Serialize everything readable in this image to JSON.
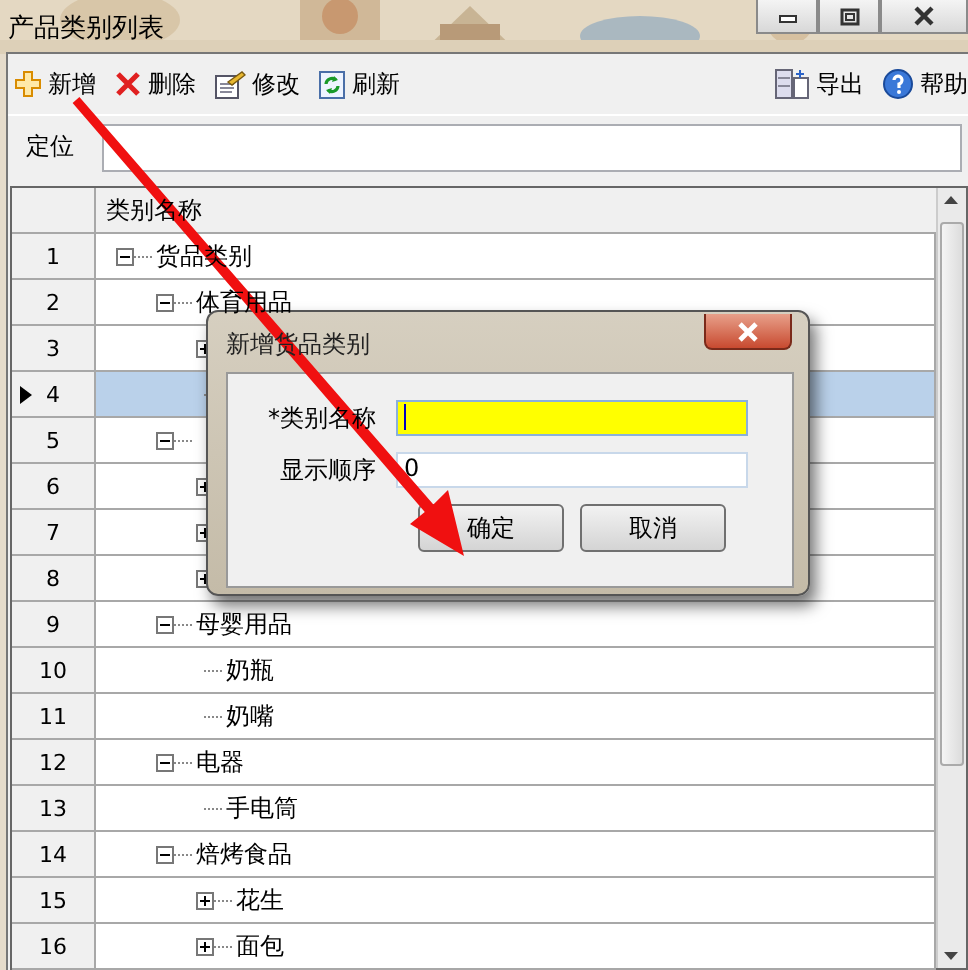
{
  "window": {
    "title": "产品类别列表"
  },
  "toolbar": {
    "left": [
      {
        "kind": "add",
        "label": "新增"
      },
      {
        "kind": "delete",
        "label": "删除"
      },
      {
        "kind": "edit",
        "label": "修改"
      },
      {
        "kind": "refresh",
        "label": "刷新"
      }
    ],
    "right": [
      {
        "kind": "export",
        "label": "导出"
      },
      {
        "kind": "help",
        "label": "帮助"
      }
    ]
  },
  "locate": {
    "label": "定位"
  },
  "grid": {
    "column_header": "类别名称",
    "rows": [
      {
        "row": "1",
        "label": "货品类别",
        "expanded": true,
        "selected": false,
        "children": [
          {
            "row": "2",
            "label": "体育用品",
            "expanded": true,
            "selected": false,
            "children": [
              {
                "row": "3",
                "expanded": false,
                "selected": false
              },
              {
                "row": "4",
                "selected": true
              }
            ]
          },
          {
            "row": "5",
            "expanded": true,
            "selected": false,
            "children": [
              {
                "row": "6",
                "expanded": false,
                "selected": false
              },
              {
                "row": "7",
                "expanded": false,
                "selected": false
              },
              {
                "row": "8",
                "expanded": false,
                "selected": false
              }
            ]
          },
          {
            "row": "9",
            "label": "母婴用品",
            "expanded": true,
            "selected": false,
            "children": [
              {
                "row": "10",
                "label": "奶瓶",
                "selected": false
              },
              {
                "row": "11",
                "label": "奶嘴",
                "selected": false
              }
            ]
          },
          {
            "row": "12",
            "label": "电器",
            "expanded": true,
            "selected": false,
            "children": [
              {
                "row": "13",
                "label": "手电筒",
                "selected": false
              }
            ]
          },
          {
            "row": "14",
            "label": "焙烤食品",
            "expanded": true,
            "selected": false,
            "children": [
              {
                "row": "15",
                "label": "花生",
                "expanded": false,
                "selected": false
              },
              {
                "row": "16",
                "label": "面包",
                "expanded": false,
                "selected": false
              }
            ]
          }
        ]
      }
    ]
  },
  "dialog": {
    "title": "新增货品类别",
    "fields": [
      {
        "label": "*类别名称",
        "focused": true
      },
      {
        "label": "显示顺序",
        "value": "0",
        "focused": false
      }
    ],
    "buttons": [
      "确定",
      "取消"
    ]
  }
}
